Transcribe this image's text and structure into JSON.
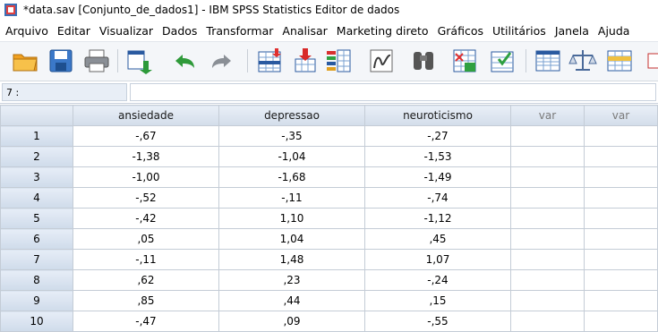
{
  "window": {
    "title": "*data.sav [Conjunto_de_dados1] - IBM SPSS Statistics Editor de dados"
  },
  "menu": [
    {
      "label": "Arquivo"
    },
    {
      "label": "Editar"
    },
    {
      "label": "Visualizar"
    },
    {
      "label": "Dados"
    },
    {
      "label": "Transformar"
    },
    {
      "label": "Analisar"
    },
    {
      "label": "Marketing direto"
    },
    {
      "label": "Gráficos"
    },
    {
      "label": "Utilitários"
    },
    {
      "label": "Janela"
    },
    {
      "label": "Ajuda"
    }
  ],
  "toolbar": {
    "icons": [
      "open-folder-icon",
      "save-icon",
      "print-icon",
      "dialog-recall-icon",
      "undo-icon",
      "redo-icon",
      "goto-case-icon",
      "goto-variable-icon",
      "variables-icon",
      "run-descriptives-icon",
      "find-icon",
      "insert-cases-icon",
      "insert-variable-icon",
      "split-file-icon",
      "weight-cases-icon",
      "select-cases-icon"
    ]
  },
  "cellbar": {
    "reference": "7 :",
    "value": ""
  },
  "grid": {
    "columns": [
      "ansiedade",
      "depressao",
      "neuroticismo",
      "var",
      "var"
    ],
    "rows": [
      {
        "num": "1",
        "ansiedade": "-,67",
        "depressao": "-,35",
        "neuroticismo": "-,27"
      },
      {
        "num": "2",
        "ansiedade": "-1,38",
        "depressao": "-1,04",
        "neuroticismo": "-1,53"
      },
      {
        "num": "3",
        "ansiedade": "-1,00",
        "depressao": "-1,68",
        "neuroticismo": "-1,49"
      },
      {
        "num": "4",
        "ansiedade": "-,52",
        "depressao": "-,11",
        "neuroticismo": "-,74"
      },
      {
        "num": "5",
        "ansiedade": "-,42",
        "depressao": "1,10",
        "neuroticismo": "-1,12"
      },
      {
        "num": "6",
        "ansiedade": ",05",
        "depressao": "1,04",
        "neuroticismo": ",45"
      },
      {
        "num": "7",
        "ansiedade": "-,11",
        "depressao": "1,48",
        "neuroticismo": "1,07"
      },
      {
        "num": "8",
        "ansiedade": ",62",
        "depressao": ",23",
        "neuroticismo": "-,24"
      },
      {
        "num": "9",
        "ansiedade": ",85",
        "depressao": ",44",
        "neuroticismo": ",15"
      },
      {
        "num": "10",
        "ansiedade": "-,47",
        "depressao": ",09",
        "neuroticismo": "-,55"
      }
    ]
  }
}
